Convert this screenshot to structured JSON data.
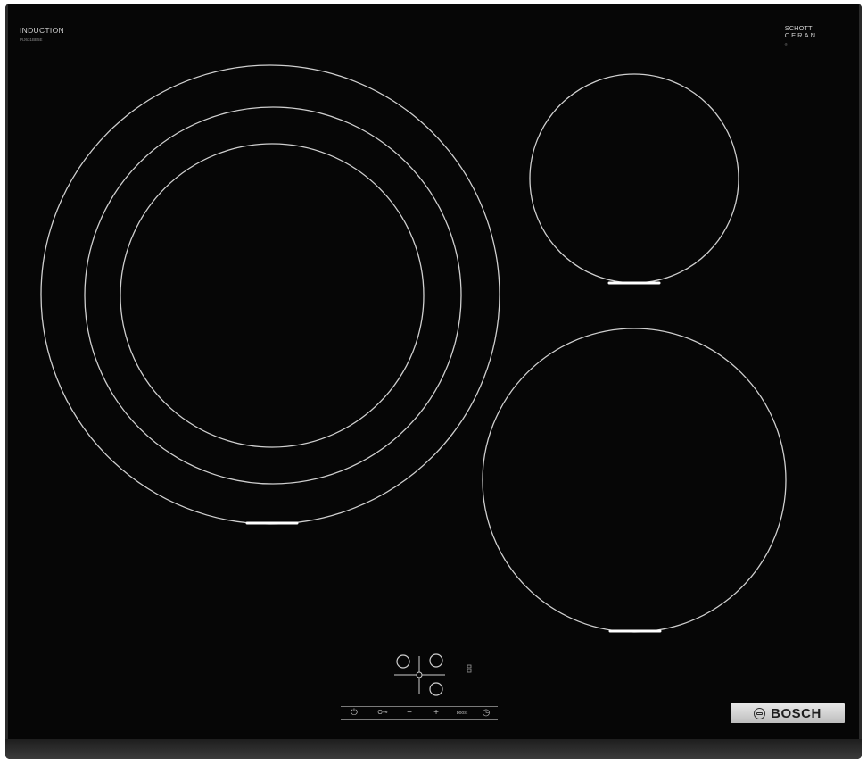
{
  "hob": {
    "type_label": "INDUCTION",
    "model_code": "PIJ631BB5E",
    "glass_brand_line1": "SCHOTT",
    "glass_brand_line2": "CERAN",
    "glass_brand_sub": "®",
    "brand_name": "BOSCH",
    "controls": {
      "power_symbol": "⏻",
      "key_symbol": "O⊸",
      "minus_symbol": "−",
      "plus_symbol": "+",
      "boost_label": "boost",
      "timer_symbol": "◷"
    }
  }
}
